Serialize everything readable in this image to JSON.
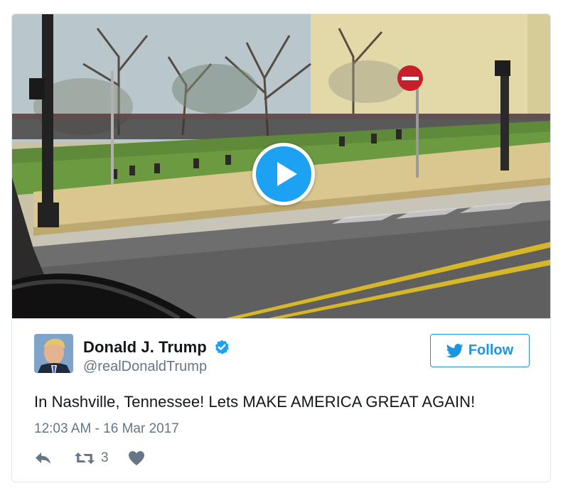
{
  "video": {
    "sign_text": "DO NOT ENTER"
  },
  "tweet": {
    "display_name": "Donald J. Trump",
    "handle": "@realDonaldTrump",
    "follow_label": "Follow",
    "text": "In Nashville, Tennessee! Lets MAKE AMERICA GREAT AGAIN!",
    "timestamp": "12:03 AM - 16 Mar 2017",
    "retweet_count": "3"
  },
  "colors": {
    "accent": "#1da1f2",
    "follow_border": "#1b95e0",
    "text_primary": "#14171a",
    "text_secondary": "#657786",
    "border": "#e1e8ed"
  },
  "icons": [
    "play-icon",
    "verified-icon",
    "twitter-bird-icon",
    "reply-icon",
    "retweet-icon",
    "heart-icon"
  ]
}
